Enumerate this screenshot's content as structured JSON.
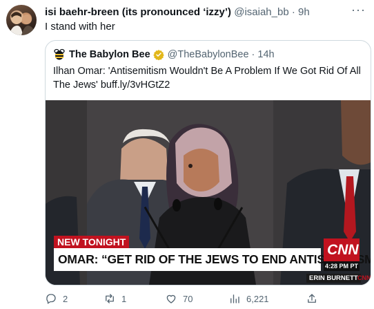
{
  "tweet": {
    "author_name": "isi baehr-breen (its pronounced ‘izzy’)",
    "handle": "@isaiah_bb",
    "separator": "·",
    "time": "9h",
    "text": "I stand with her",
    "more_label": "···"
  },
  "quote": {
    "author_name": "The Babylon Bee",
    "handle": "@TheBabylonBee",
    "separator": "·",
    "time": "14h",
    "text": "Ilhan Omar: 'Antisemitism Wouldn't Be A Problem If We Got Rid Of All The Jews' buff.ly/3vHGtZ2",
    "verified_color": "#e2b719",
    "image": {
      "chyron_top": "NEW TONIGHT",
      "chyron_main": "OMAR: “GET RID OF THE JEWS TO END ANTISEMITISM”",
      "network_logo": "CNN",
      "time_label": "4:28 PM PT",
      "reporter": "ERIN BURNETT",
      "network_small": "CNN"
    }
  },
  "actions": {
    "replies": "2",
    "retweets": "1",
    "likes": "70",
    "views": "6,221"
  },
  "colors": {
    "text": "#0f1419",
    "muted": "#536471",
    "border": "#cfd9de",
    "cnn_red": "#c1121f"
  }
}
